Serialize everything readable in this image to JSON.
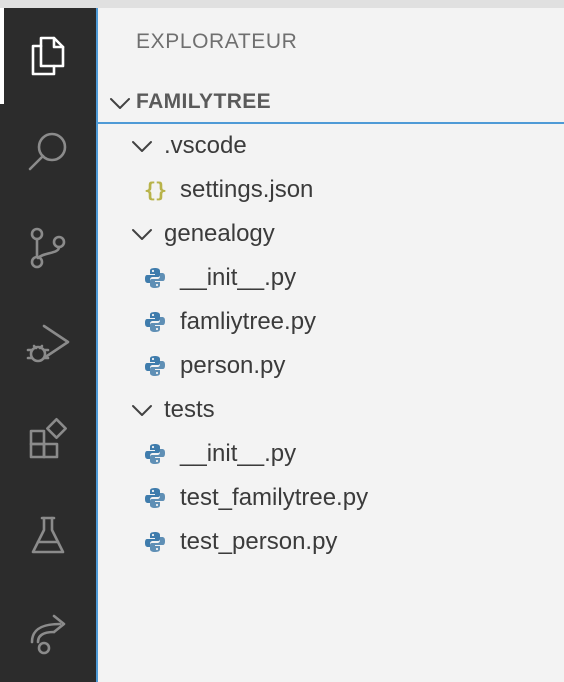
{
  "activity_bar": {
    "items": [
      {
        "icon": "files-icon",
        "active": true
      },
      {
        "icon": "search-icon",
        "active": false
      },
      {
        "icon": "source-control-icon",
        "active": false
      },
      {
        "icon": "run-debug-icon",
        "active": false
      },
      {
        "icon": "extensions-icon",
        "active": false
      },
      {
        "icon": "testing-icon",
        "active": false
      },
      {
        "icon": "remote-share-icon",
        "active": false
      }
    ]
  },
  "sidebar": {
    "title": "EXPLORATEUR",
    "section": {
      "label": "FAMILYTREE",
      "expanded": true
    },
    "tree": [
      {
        "label": ".vscode",
        "type": "folder",
        "expanded": true
      },
      {
        "label": "settings.json",
        "type": "json",
        "icon_text": "{}"
      },
      {
        "label": "genealogy",
        "type": "folder",
        "expanded": true
      },
      {
        "label": "__init__.py",
        "type": "python"
      },
      {
        "label": "famliytree.py",
        "type": "python"
      },
      {
        "label": "person.py",
        "type": "python"
      },
      {
        "label": "tests",
        "type": "folder",
        "expanded": true
      },
      {
        "label": "__init__.py",
        "type": "python"
      },
      {
        "label": "test_familytree.py",
        "type": "python"
      },
      {
        "label": "test_person.py",
        "type": "python"
      }
    ]
  },
  "colors": {
    "activity_bar_bg": "#2c2c2c",
    "sidebar_bg": "#f3f3f3",
    "focus_border": "#4e9ad6",
    "json_icon": "#b8b34a",
    "python_blue": "#3f7cac"
  }
}
